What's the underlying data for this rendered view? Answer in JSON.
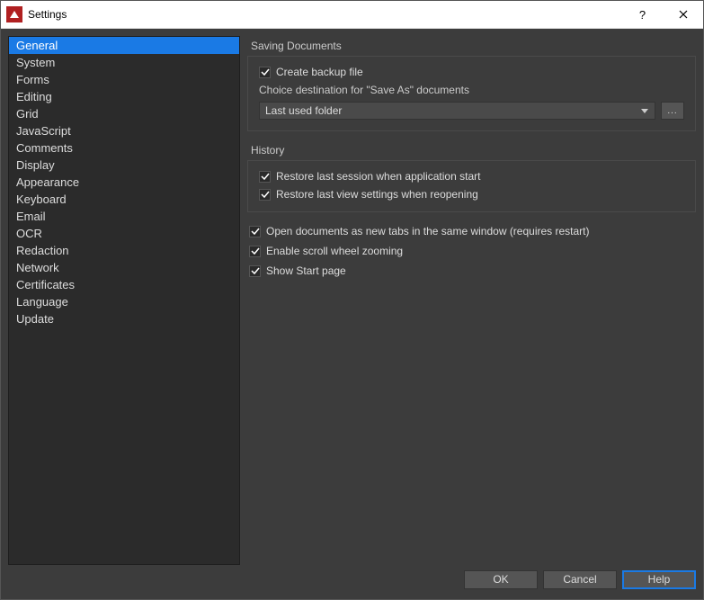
{
  "window": {
    "title": "Settings"
  },
  "sidebar": {
    "items": [
      "General",
      "System",
      "Forms",
      "Editing",
      "Grid",
      "JavaScript",
      "Comments",
      "Display",
      "Appearance",
      "Keyboard",
      "Email",
      "OCR",
      "Redaction",
      "Network",
      "Certificates",
      "Language",
      "Update"
    ],
    "selected_index": 0
  },
  "content": {
    "saving": {
      "group_label": "Saving Documents",
      "create_backup": "Create backup file",
      "choice_label": "Choice destination for \"Save As\" documents",
      "destination_selected": "Last used folder",
      "browse_label": "..."
    },
    "history": {
      "group_label": "History",
      "restore_session": "Restore last session when application start",
      "restore_view": "Restore last view settings when reopening"
    },
    "open_tabs": "Open documents as new tabs in the same window (requires restart)",
    "scroll_zoom": "Enable scroll wheel zooming",
    "start_page": "Show Start page"
  },
  "footer": {
    "ok": "OK",
    "cancel": "Cancel",
    "help": "Help"
  }
}
